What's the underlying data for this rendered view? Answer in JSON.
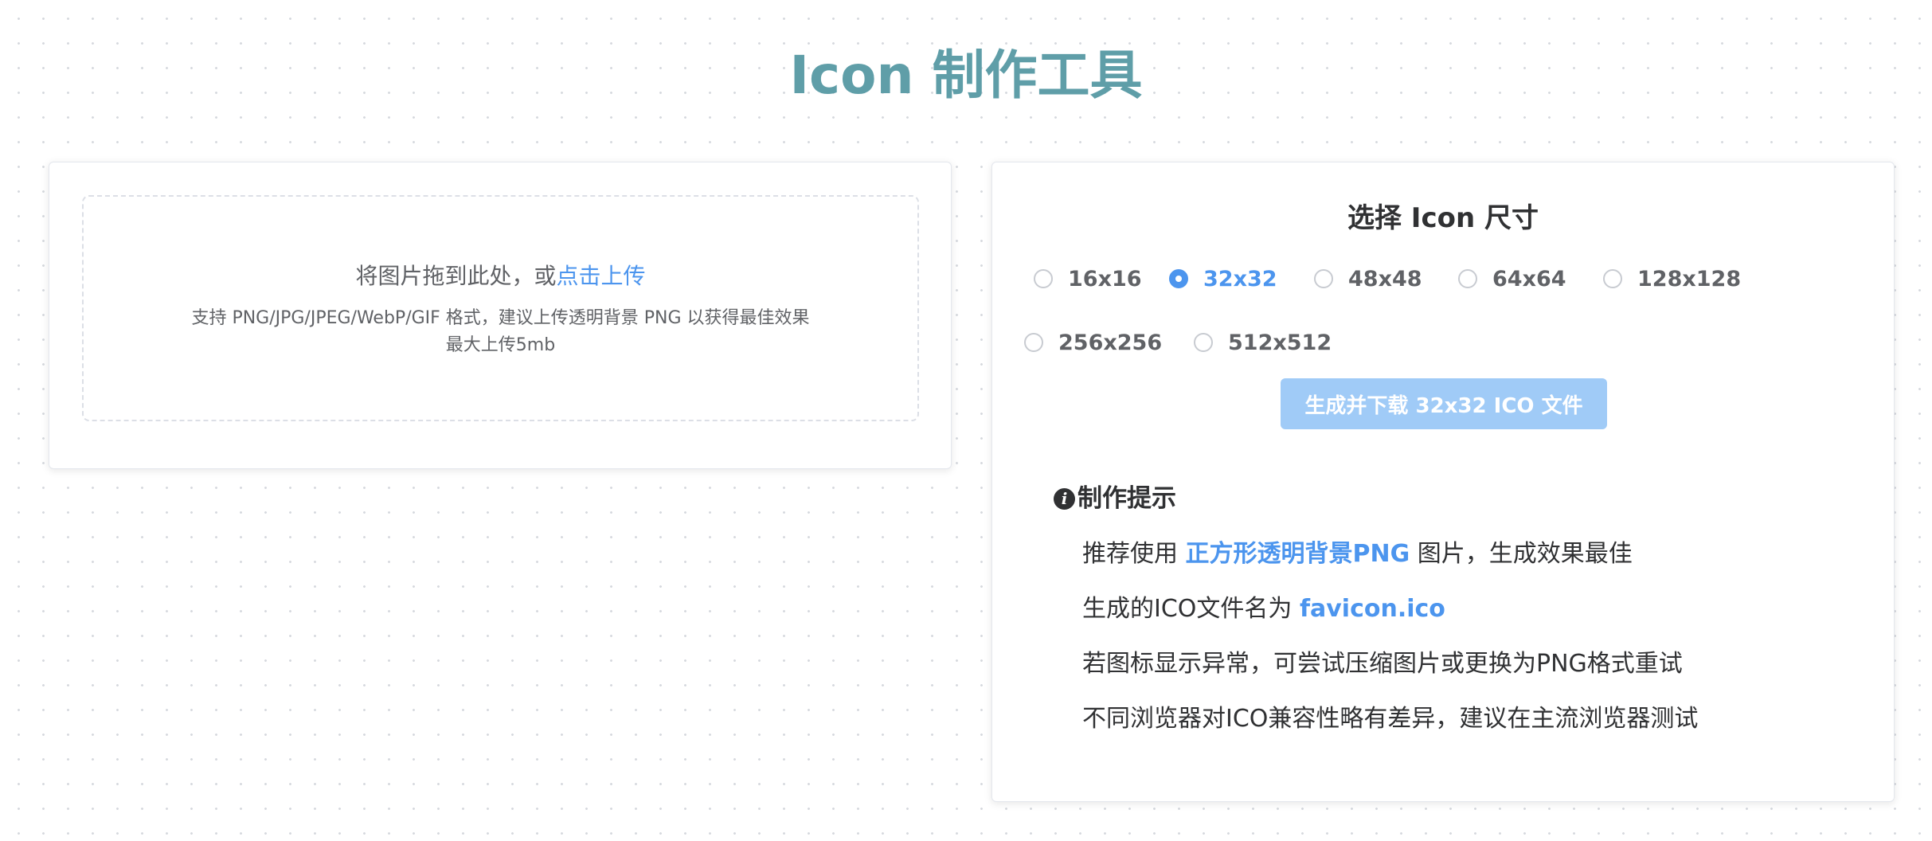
{
  "header": {
    "title": "Icon 制作工具"
  },
  "upload": {
    "drop_text": "将图片拖到此处，或",
    "drop_link": "点击上传",
    "hint_line1": "支持 PNG/JPG/JPEG/WebP/GIF 格式，建议上传透明背景 PNG 以获得最佳效果",
    "hint_line2": "最大上传5mb"
  },
  "settings": {
    "title": "选择 Icon 尺寸",
    "selected_size": "32x32",
    "sizes": [
      "16x16",
      "32x32",
      "48x48",
      "64x64",
      "128x128",
      "256x256",
      "512x512"
    ],
    "generate_button": "生成并下载 32x32 ICO 文件",
    "button_state": "disabled"
  },
  "tips": {
    "title": "制作提示",
    "icon": "info-circle-icon",
    "items": [
      {
        "before": "推荐使用 ",
        "highlight": "正方形透明背景PNG",
        "after": " 图片，生成效果最佳"
      },
      {
        "before": "生成的ICO文件名为 ",
        "highlight": "favicon.ico",
        "after": ""
      },
      {
        "before": "若图标显示异常，可尝试压缩图片或更换为PNG格式重试",
        "highlight": "",
        "after": ""
      },
      {
        "before": "不同浏览器对ICO兼容性略有差异，建议在主流浏览器测试",
        "highlight": "",
        "after": ""
      }
    ]
  },
  "colors": {
    "title": "#5f9ea8",
    "accent": "#4c95ee",
    "button_disabled": "#a0cbf7",
    "text_primary": "#303133",
    "text_secondary": "#606266"
  }
}
